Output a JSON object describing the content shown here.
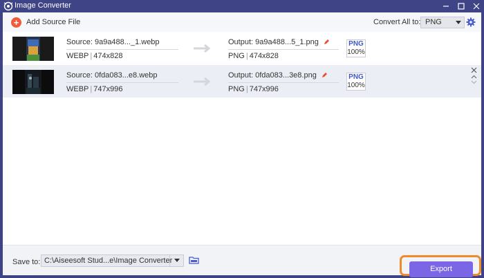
{
  "window": {
    "title": "Image Converter"
  },
  "toolbar": {
    "add_label": "Add Source File",
    "convert_all_label": "Convert All to:",
    "convert_all_value": "PNG"
  },
  "files": [
    {
      "source": "Source: 9a9a488..._1.webp",
      "src_format": "WEBP",
      "src_dims": "474x828",
      "output": "Output: 9a9a488...5_1.png",
      "out_format": "PNG",
      "out_dims": "474x828",
      "badge_format": "PNG",
      "badge_quality": "100%"
    },
    {
      "source": "Source: 0fda083...e8.webp",
      "src_format": "WEBP",
      "src_dims": "747x996",
      "output": "Output: 0fda083...3e8.png",
      "out_format": "PNG",
      "out_dims": "747x996",
      "badge_format": "PNG",
      "badge_quality": "100%"
    }
  ],
  "bottom": {
    "save_label": "Save to:",
    "save_path": "C:\\Aiseesoft Stud...e\\Image Converter",
    "export_label": "Export"
  },
  "colors": {
    "titlebar": "#3f4487",
    "accent": "#7b67e6",
    "highlight": "#f08a2b",
    "add_icon": "#f05b3b",
    "badge_text": "#3c57c9"
  }
}
